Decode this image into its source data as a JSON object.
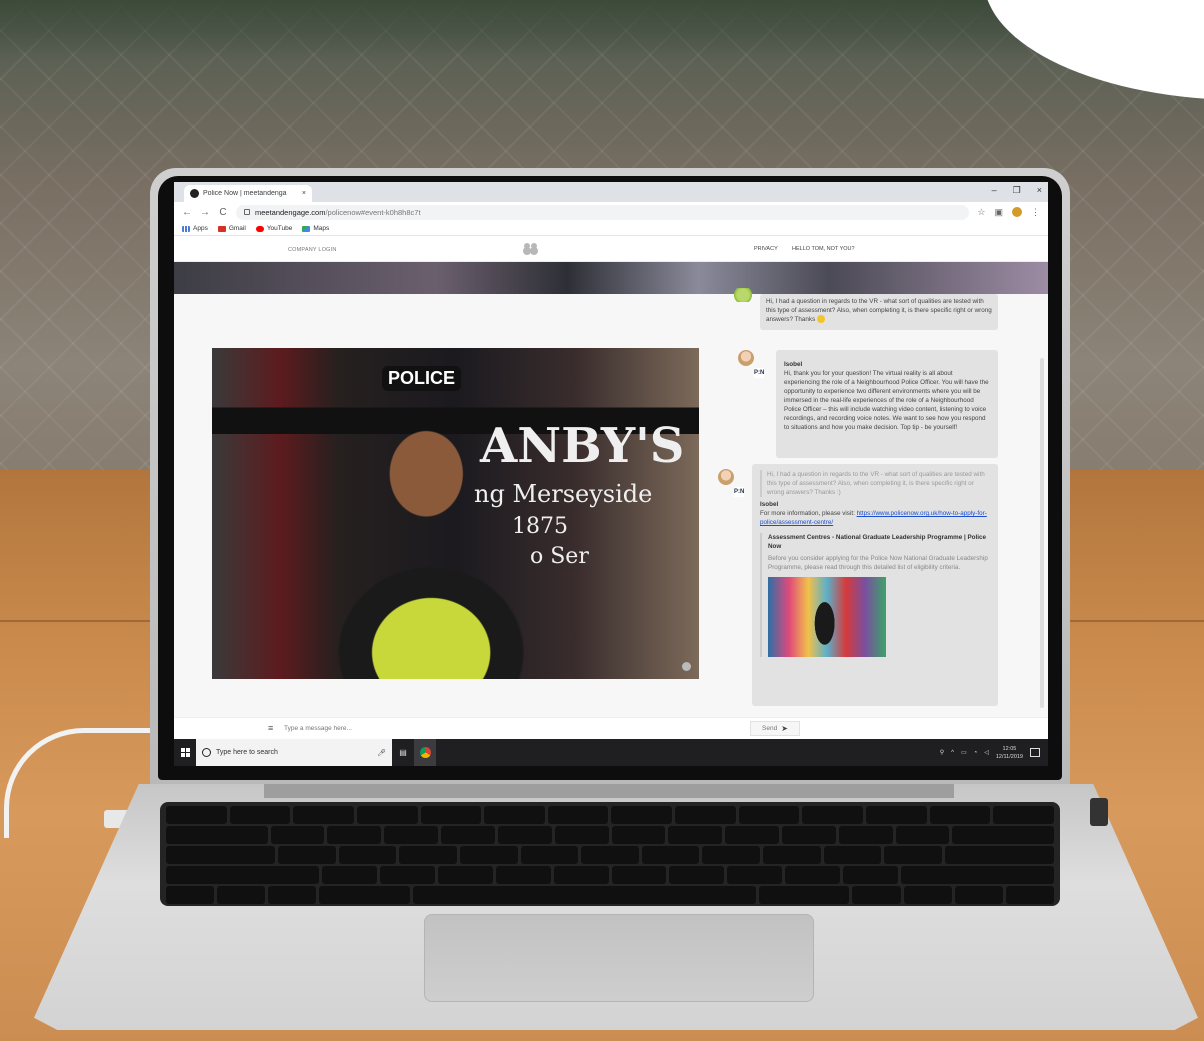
{
  "browser": {
    "tab_title": "Police Now | meetandenga",
    "tab_close": "×",
    "url_host": "meetandengage.com",
    "url_path": "/policenow#event-k0h8h8c7t",
    "nav_back": "←",
    "nav_forward": "→",
    "nav_reload": "C",
    "win_minimize": "–",
    "win_restore": "❐",
    "win_close": "×",
    "bookmarks": [
      "Apps",
      "Gmail",
      "YouTube",
      "Maps"
    ]
  },
  "site": {
    "logo_text": "P:N",
    "company_login": "COMPANY LOGIN",
    "privacy": "PRIVACY",
    "hello": "HELLO TOM, NOT YOU?"
  },
  "video": {
    "police_text": "POLICE",
    "sign_line1": "ANBY'S",
    "sign_line2": "ng Merseyside",
    "sign_line3": "1875",
    "sign_line4": "o Ser"
  },
  "chat": {
    "messages": [
      {
        "text": "Hi, I had a question in regards to the VR - what sort of qualities are tested with this type of assessment? Also, when completing it, is there specific right or wrong answers? Thanks"
      },
      {
        "sender": "Isobel",
        "text": "Hi, thank you for your question! The virtual reality is all about experiencing the role of a Neighbourhood Police Officer. You will have the opportunity to experience two different environments where you will be immersed in the real-life experiences of the role of a Neighbourhood Police Officer – this will include watching video content, listening to voice recordings, and recording voice notes. We want to see how you respond to situations and how you make decision. Top tip - be yourself!"
      },
      {
        "quoted": "Hi, I had a question in regards to the VR - what sort of qualities are tested with this type of assessment? Also, when completing it, is there specific right or wrong answers? Thanks :)",
        "sender": "Isobel",
        "text": "For more information, please visit:",
        "link": "https://www.policenow.org.uk/how-to-apply-for-police/assessment-centre/",
        "preview_title": "Assessment Centres - National Graduate Leadership Programme | Police Now",
        "preview_desc": "Before you consider applying for the Police Now National Graduate Leadership Programme, please read through this detailed list of eligibility criteria."
      }
    ],
    "badge": "P:N",
    "input_placeholder": "Type a message here...",
    "send_label": "Send",
    "menu_glyph": "≡",
    "send_glyph": "➤"
  },
  "taskbar": {
    "search_placeholder": "Type here to search",
    "time": "12:05",
    "date": "12/11/2019"
  }
}
